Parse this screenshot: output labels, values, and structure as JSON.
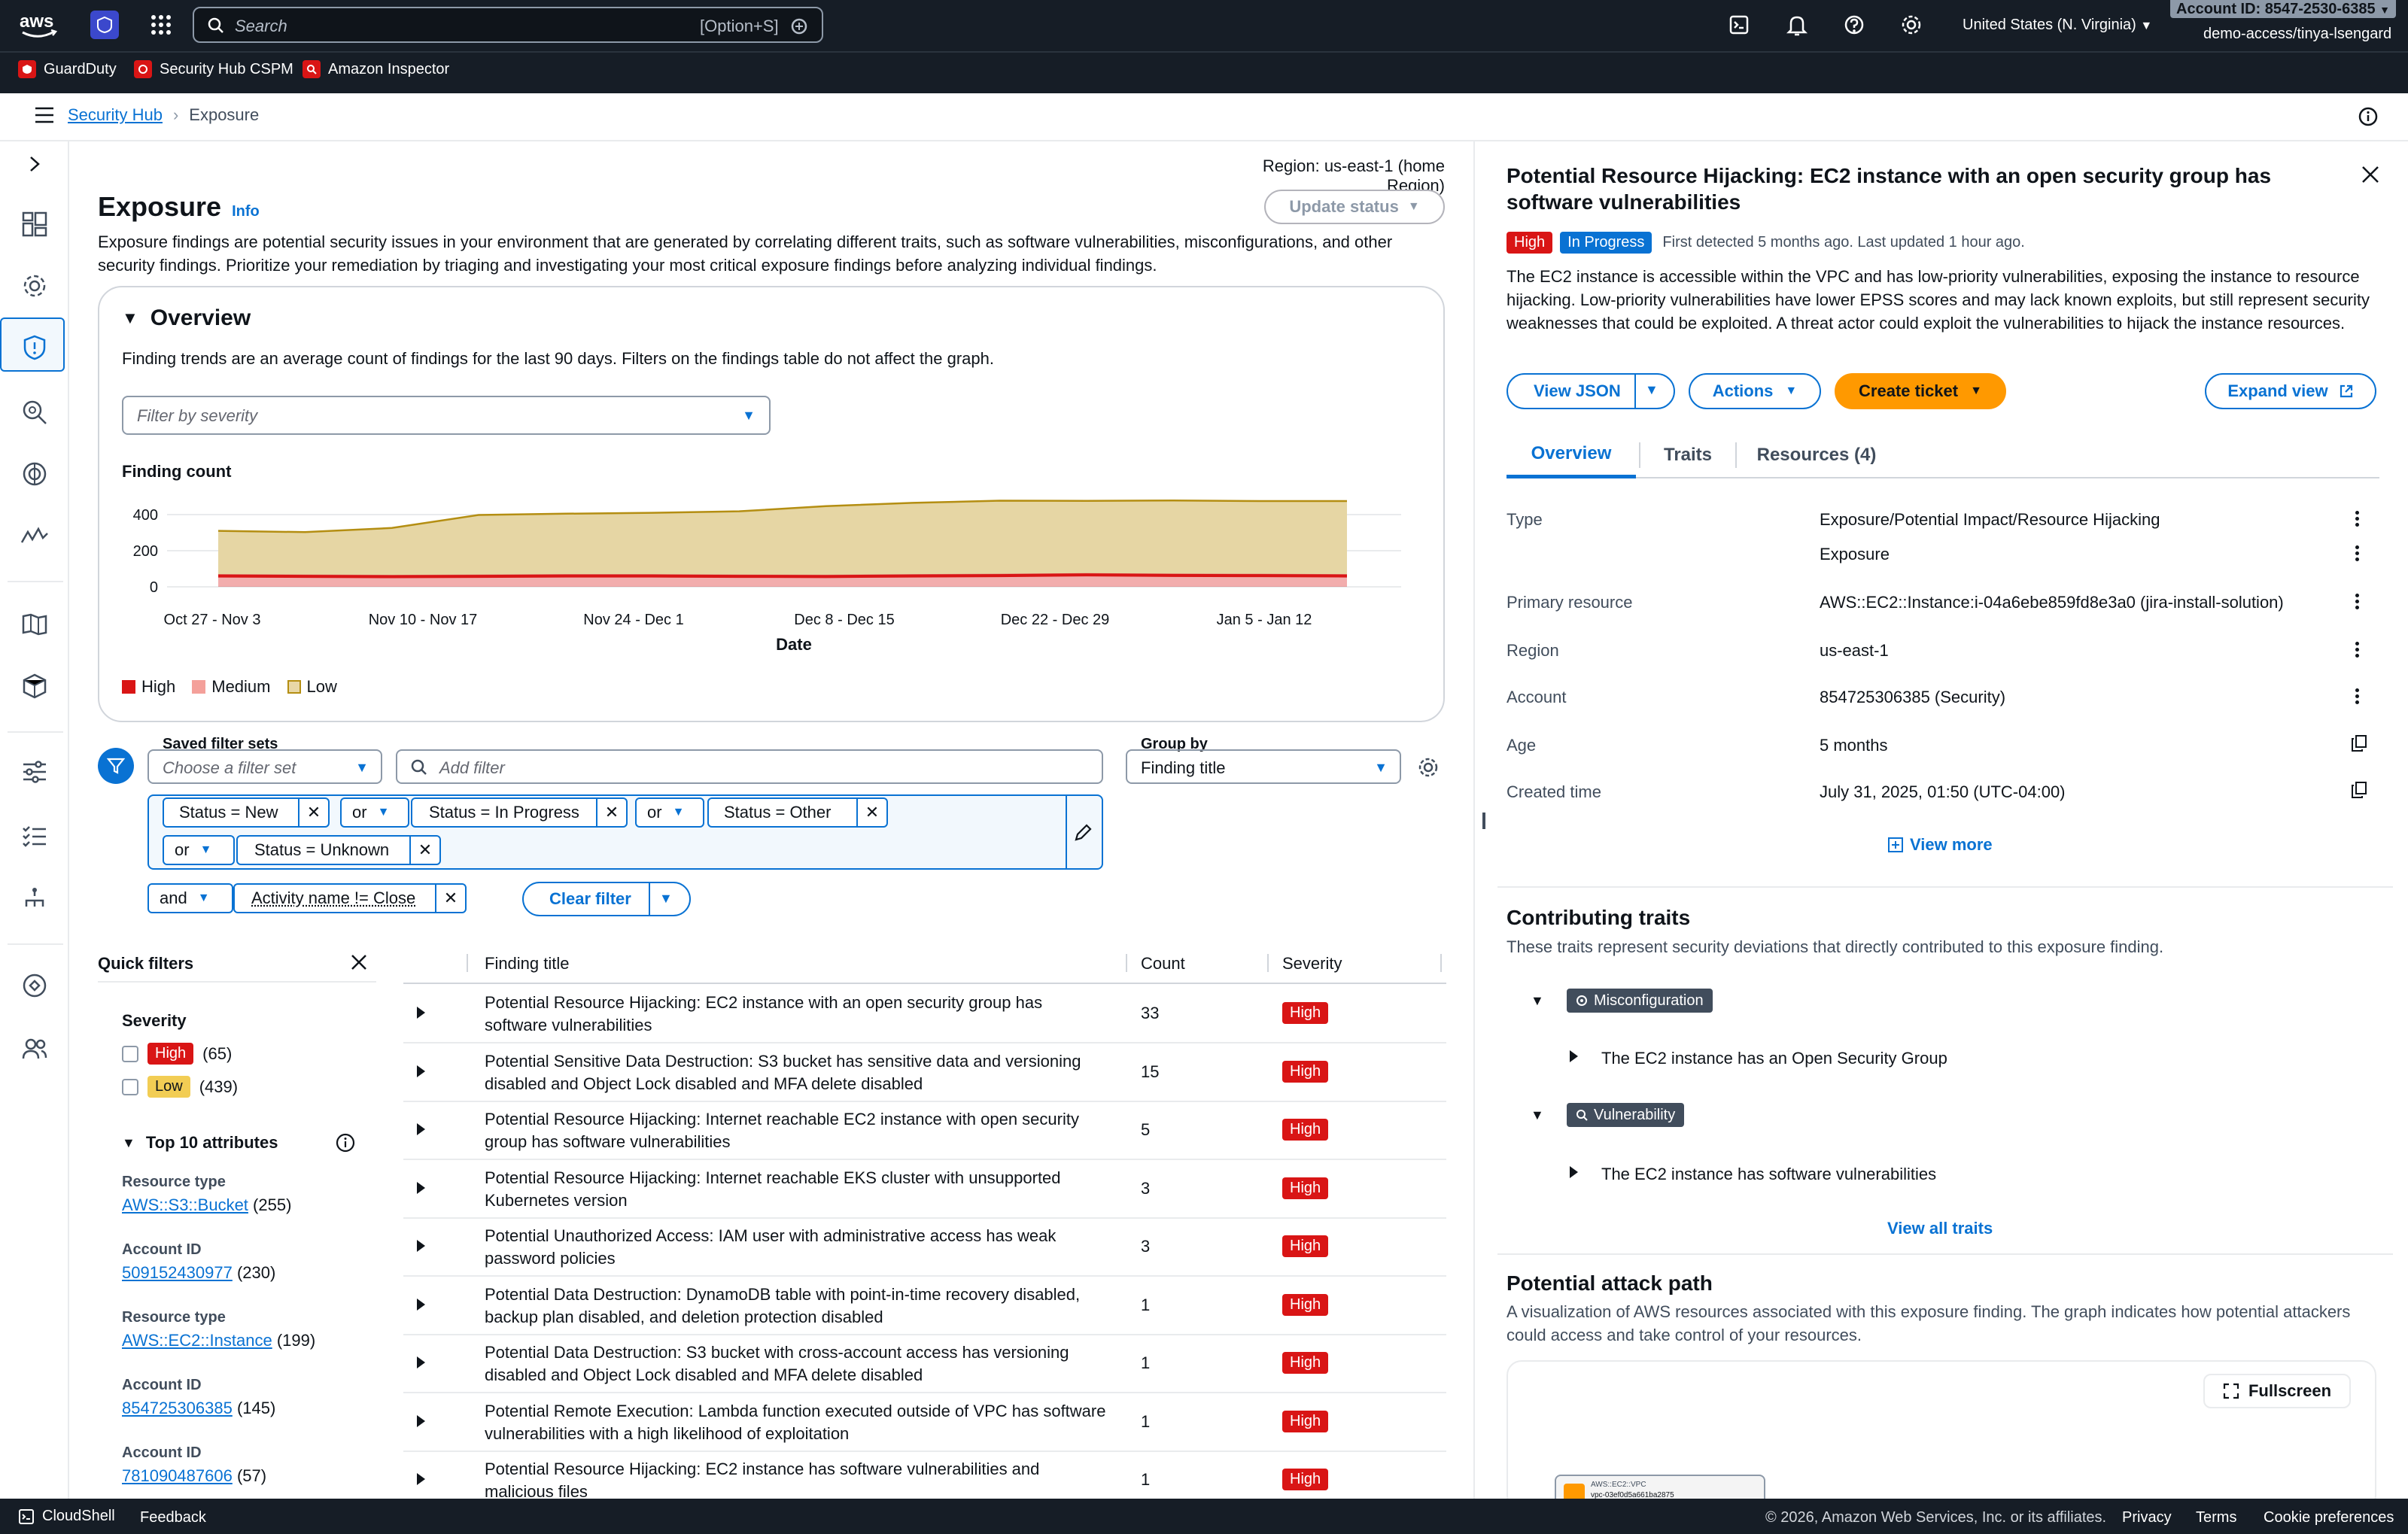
{
  "topnav": {
    "search_placeholder": "Search",
    "search_shortcut": "[Option+S]",
    "region": "United States (N. Virginia)",
    "account_id": "Account ID: 8547-2530-6385",
    "user": "demo-access/tinya-lsengard"
  },
  "favorites": [
    "GuardDuty",
    "Security Hub CSPM",
    "Amazon Inspector"
  ],
  "breadcrumb": {
    "root": "Security Hub",
    "current": "Exposure"
  },
  "page": {
    "region_label": "Region: us-east-1 (home Region)",
    "title": "Exposure",
    "info": "Info",
    "update_status": "Update status",
    "description": "Exposure findings are potential security issues in your environment that are generated by correlating different traits, such as software vulnerabilities, misconfigurations, and other security findings. Prioritize your remediation by triaging and investigating your most critical exposure findings before analyzing individual findings."
  },
  "overview": {
    "title": "Overview",
    "note": "Finding trends are an average count of findings for the last 90 days. Filters on the findings table do not affect the graph.",
    "severity_filter_placeholder": "Filter by severity"
  },
  "chart_data": {
    "type": "area",
    "title": "Finding count",
    "xlabel": "Date",
    "ylabel": "",
    "ylim": [
      0,
      500
    ],
    "yticks": [
      0,
      200,
      400
    ],
    "x_tick_labels": [
      "Oct 27 - Nov 3",
      "Nov 10 - Nov 17",
      "Nov 24 - Dec 1",
      "Dec 8 - Dec 15",
      "Dec 22 - Dec 29",
      "Jan 5 - Jan 12"
    ],
    "x": [
      0,
      1,
      2,
      3,
      4,
      5,
      6,
      7,
      8,
      9,
      10,
      11,
      12,
      13
    ],
    "series": [
      {
        "name": "High",
        "color": "#d91515",
        "values": [
          60,
          58,
          56,
          58,
          60,
          60,
          58,
          57,
          60,
          62,
          66,
          63,
          62,
          60
        ]
      },
      {
        "name": "Medium",
        "color": "#f4a09a",
        "values": [
          5,
          5,
          5,
          5,
          5,
          5,
          5,
          5,
          5,
          5,
          5,
          5,
          5,
          5
        ]
      },
      {
        "name": "Low",
        "color": "#e8d7a6",
        "values": [
          245,
          240,
          265,
          335,
          340,
          345,
          355,
          385,
          400,
          410,
          405,
          410,
          408,
          410
        ]
      }
    ],
    "legend_position": "bottom-left"
  },
  "filters": {
    "saved_label": "Saved filter sets",
    "saved_placeholder": "Choose a filter set",
    "add_placeholder": "Add filter",
    "group_label": "Group by",
    "group_value": "Finding title",
    "tokens": [
      "Status = New",
      "Status = In Progress",
      "Status = Other",
      "Status = Unknown",
      "Activity name != Close"
    ],
    "ops": [
      "or",
      "or",
      "or",
      "and"
    ],
    "clear": "Clear filter"
  },
  "quick_filters": {
    "title": "Quick filters",
    "severity_label": "Severity",
    "sev_items": [
      {
        "label": "High",
        "count": "(65)"
      },
      {
        "label": "Low",
        "count": "(439)"
      }
    ],
    "top_attrs": "Top 10 attributes",
    "attrs": [
      {
        "k": "Resource type",
        "v": "AWS::S3::Bucket",
        "c": "(255)"
      },
      {
        "k": "Account ID",
        "v": "509152430977",
        "c": "(230)"
      },
      {
        "k": "Resource type",
        "v": "AWS::EC2::Instance",
        "c": "(199)"
      },
      {
        "k": "Account ID",
        "v": "854725306385",
        "c": "(145)"
      },
      {
        "k": "Account ID",
        "v": "781090487606",
        "c": "(57)"
      }
    ]
  },
  "table": {
    "headers": [
      "Finding title",
      "Count",
      "Severity"
    ],
    "rows": [
      {
        "title": "Potential Resource Hijacking: EC2 instance with an open security group has software vulnerabilities",
        "count": "33",
        "sev": "High"
      },
      {
        "title": "Potential Sensitive Data Destruction: S3 bucket has sensitive data and versioning disabled and Object Lock disabled and MFA delete disabled",
        "count": "15",
        "sev": "High"
      },
      {
        "title": "Potential Resource Hijacking: Internet reachable EC2 instance with open security group has software vulnerabilities",
        "count": "5",
        "sev": "High"
      },
      {
        "title": "Potential Resource Hijacking: Internet reachable EKS cluster with unsupported Kubernetes version",
        "count": "3",
        "sev": "High"
      },
      {
        "title": "Potential Unauthorized Access: IAM user with administrative access has weak password policies",
        "count": "3",
        "sev": "High"
      },
      {
        "title": "Potential Data Destruction: DynamoDB table with point-in-time recovery disabled, backup plan disabled, and deletion protection disabled",
        "count": "1",
        "sev": "High"
      },
      {
        "title": "Potential Data Destruction: S3 bucket with cross-account access has versioning disabled and Object Lock disabled and MFA delete disabled",
        "count": "1",
        "sev": "High"
      },
      {
        "title": "Potential Remote Execution: Lambda function executed outside of VPC has software vulnerabilities with a high likelihood of exploitation",
        "count": "1",
        "sev": "High"
      },
      {
        "title": "Potential Resource Hijacking: EC2 instance has software vulnerabilities and malicious files",
        "count": "1",
        "sev": "High"
      }
    ]
  },
  "panel": {
    "title": "Potential Resource Hijacking: EC2 instance with an open security group has software vulnerabilities",
    "sev": "High",
    "status": "In Progress",
    "detected": "First detected 5 months ago. Last updated 1 hour ago.",
    "description": "The EC2 instance is accessible within the VPC and has low-priority vulnerabilities, exposing the instance to resource hijacking. Low-priority vulnerabilities have lower EPSS scores and may lack known exploits, but still represent security weaknesses that could be exploited. A threat actor could exploit the vulnerabilities to hijack the instance resources.",
    "view_json": "View JSON",
    "actions": "Actions",
    "create_ticket": "Create ticket",
    "expand": "Expand view",
    "tabs": [
      "Overview",
      "Traits",
      "Resources (4)"
    ],
    "fields": {
      "type_k": "Type",
      "type_v1": "Exposure/Potential Impact/Resource Hijacking",
      "type_v2": "Exposure",
      "primary_k": "Primary resource",
      "primary_v": "AWS::EC2::Instance:i-04a6ebe859fd8e3a0 (jira-install-solution)",
      "region_k": "Region",
      "region_v": "us-east-1",
      "account_k": "Account",
      "account_v": "854725306385 (Security)",
      "age_k": "Age",
      "age_v": "5 months",
      "created_k": "Created time",
      "created_v": "July 31, 2025, 01:50 (UTC-04:00)"
    },
    "view_more": "View more",
    "traits_title": "Contributing traits",
    "traits_desc": "These traits represent security deviations that directly contributed to this exposure finding.",
    "trait1_tag": "Misconfiguration",
    "trait1_item": "The EC2 instance has an Open Security Group",
    "trait2_tag": "Vulnerability",
    "trait2_item": "The EC2 instance has software vulnerabilities",
    "view_all": "View all traits",
    "attack_title": "Potential attack path",
    "attack_desc": "A visualization of AWS resources associated with this exposure finding. The graph indicates how potential attackers could access and take control of your resources.",
    "fullscreen": "Fullscreen",
    "node_line1": "AWS::EC2::VPC",
    "node_line2": "vpc-03ef0d5a661ba2875"
  },
  "footer": {
    "cloudshell": "CloudShell",
    "feedback": "Feedback",
    "copyright": "© 2026, Amazon Web Services, Inc. or its affiliates.",
    "privacy": "Privacy",
    "terms": "Terms",
    "cookies": "Cookie preferences"
  }
}
